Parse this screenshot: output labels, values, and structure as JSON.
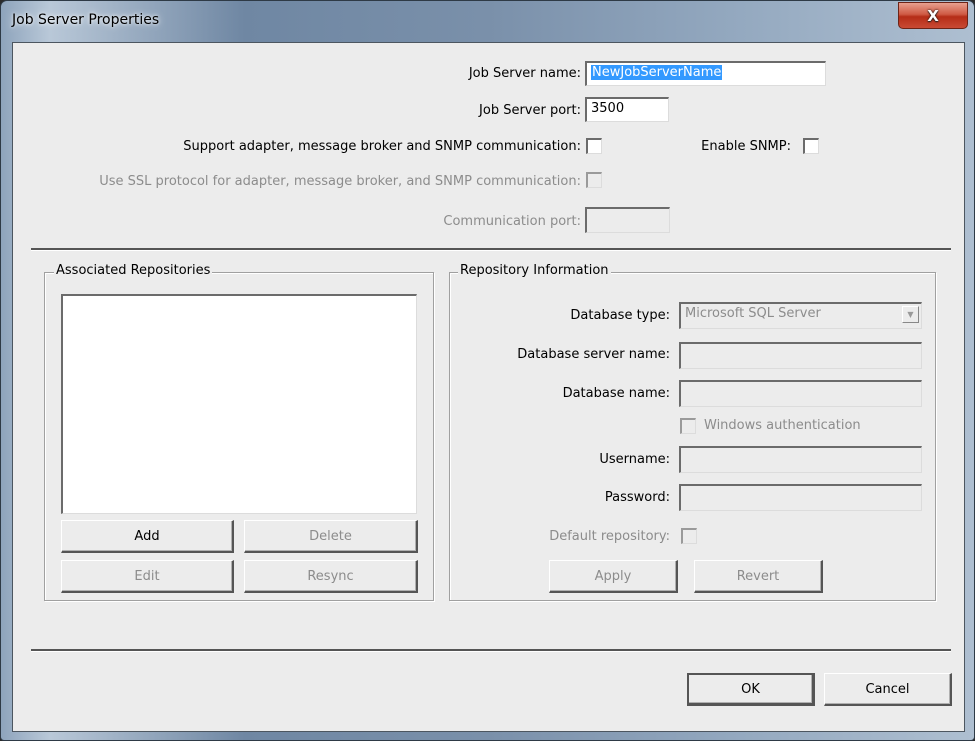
{
  "window": {
    "title": "Job Server Properties",
    "close_glyph": "X"
  },
  "general": {
    "name_label": "Job Server name:",
    "name_value": "NewJobServerName",
    "port_label": "Job Server port:",
    "port_value": "3500",
    "support_label": "Support adapter, message broker and SNMP communication:",
    "support_checked": false,
    "enable_snmp_label": "Enable SNMP:",
    "enable_snmp_checked": false,
    "ssl_label": "Use SSL protocol for adapter, message broker, and SNMP communication:",
    "ssl_checked": false,
    "comm_port_label": "Communication port:",
    "comm_port_value": ""
  },
  "associated_repositories": {
    "title": "Associated Repositories",
    "items": [],
    "buttons": {
      "add": "Add",
      "delete": "Delete",
      "edit": "Edit",
      "resync": "Resync"
    }
  },
  "repository_info": {
    "title": "Repository Information",
    "db_type_label": "Database type:",
    "db_type_value": "Microsoft SQL Server",
    "db_server_label": "Database server name:",
    "db_server_value": "",
    "db_name_label": "Database name:",
    "db_name_value": "",
    "windows_auth_label": "Windows authentication",
    "windows_auth_checked": false,
    "username_label": "Username:",
    "username_value": "",
    "password_label": "Password:",
    "password_value": "",
    "default_repo_label": "Default repository:",
    "default_repo_checked": false,
    "buttons": {
      "apply": "Apply",
      "revert": "Revert"
    }
  },
  "footer": {
    "ok": "OK",
    "cancel": "Cancel"
  }
}
